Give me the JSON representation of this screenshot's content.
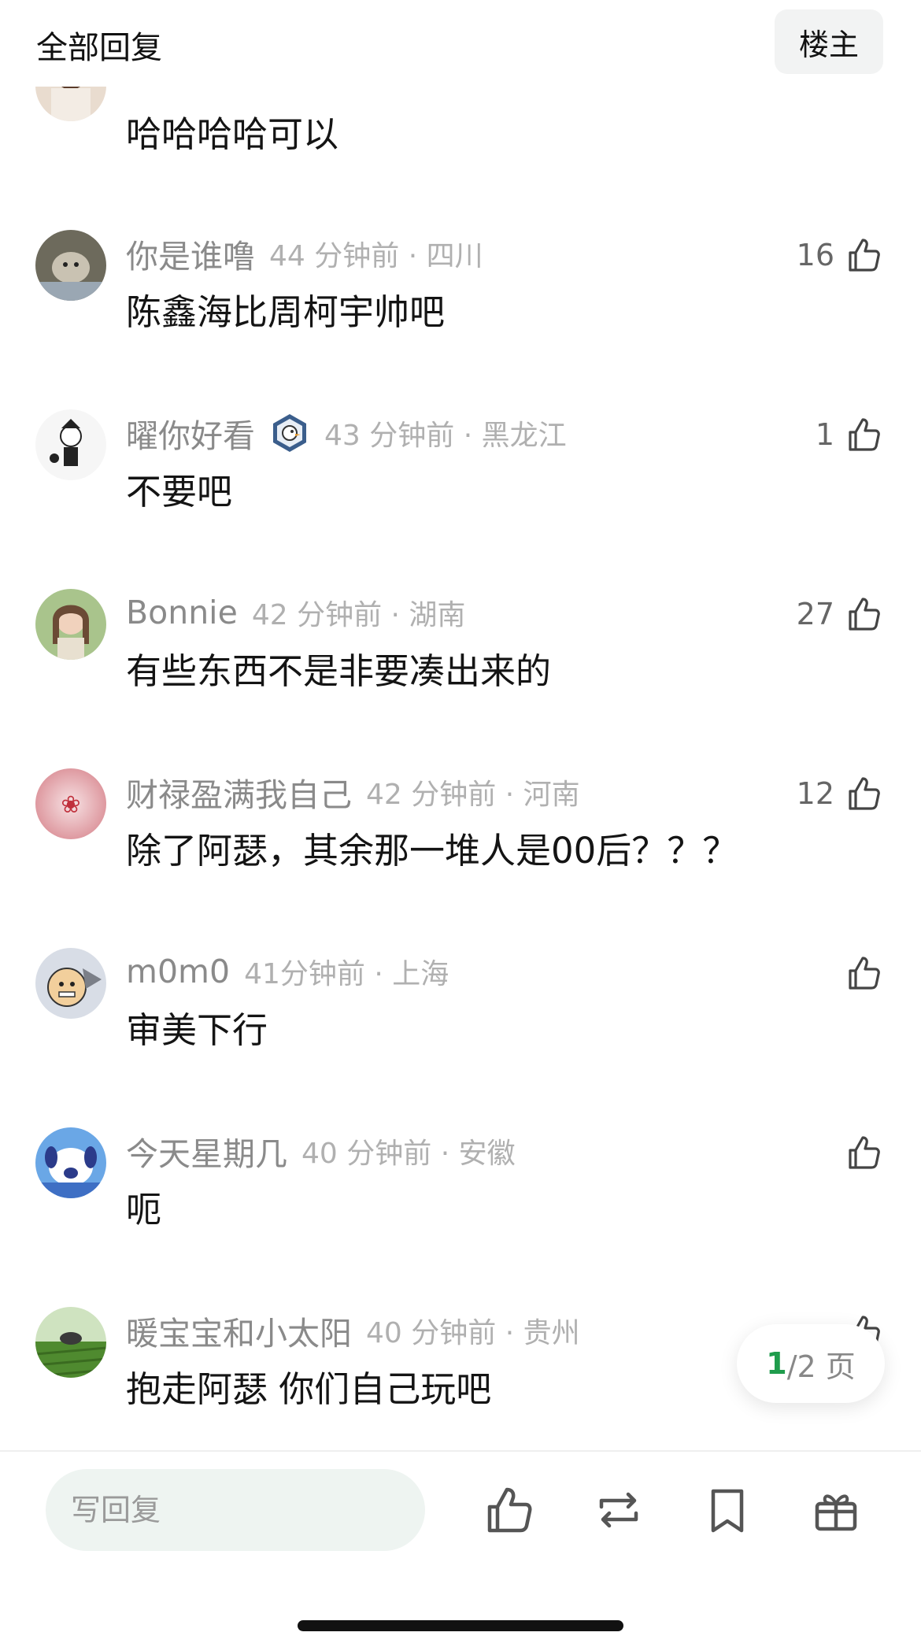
{
  "header": {
    "title": "全部回复",
    "owner_button": "楼主"
  },
  "partial_comment": {
    "content": "哈哈哈哈可以"
  },
  "comments": [
    {
      "username": "你是谁噜",
      "time_location": "44 分钟前 · 四川",
      "content": "陈鑫海比周柯宇帅吧",
      "likes": "16",
      "has_badge": false
    },
    {
      "username": "曜你好看",
      "time_location": "43 分钟前 · 黑龙江",
      "content": "不要吧",
      "likes": "1",
      "has_badge": true
    },
    {
      "username": "Bonnie",
      "time_location": "42 分钟前 · 湖南",
      "content": "有些东西不是非要凑出来的",
      "likes": "27",
      "has_badge": false
    },
    {
      "username": "财禄盈满我自己",
      "time_location": "42 分钟前 · 河南",
      "content": "除了阿瑟，其余那一堆人是00后？？？",
      "likes": "12",
      "has_badge": false
    },
    {
      "username": "m0m0",
      "time_location": "41分钟前 · 上海",
      "content": "审美下行",
      "likes": "",
      "has_badge": false
    },
    {
      "username": "今天星期几",
      "time_location": "40 分钟前 · 安徽",
      "content": "呃",
      "likes": "",
      "has_badge": false
    },
    {
      "username": "暖宝宝和小太阳",
      "time_location": "40 分钟前 · 贵州",
      "content": "抱走阿瑟 你们自己玩吧",
      "likes": "",
      "has_badge": false
    }
  ],
  "pager": {
    "current": "1",
    "total_text": "/2 页"
  },
  "bottom_bar": {
    "reply_placeholder": "写回复"
  },
  "icons": {
    "like": "thumbs-up-icon",
    "repost": "repost-icon",
    "bookmark": "bookmark-icon",
    "gift": "gift-icon"
  },
  "colors": {
    "accent_green": "#1f9c4c",
    "username_gray": "#8a8a8a",
    "meta_gray": "#b0b0b0"
  }
}
